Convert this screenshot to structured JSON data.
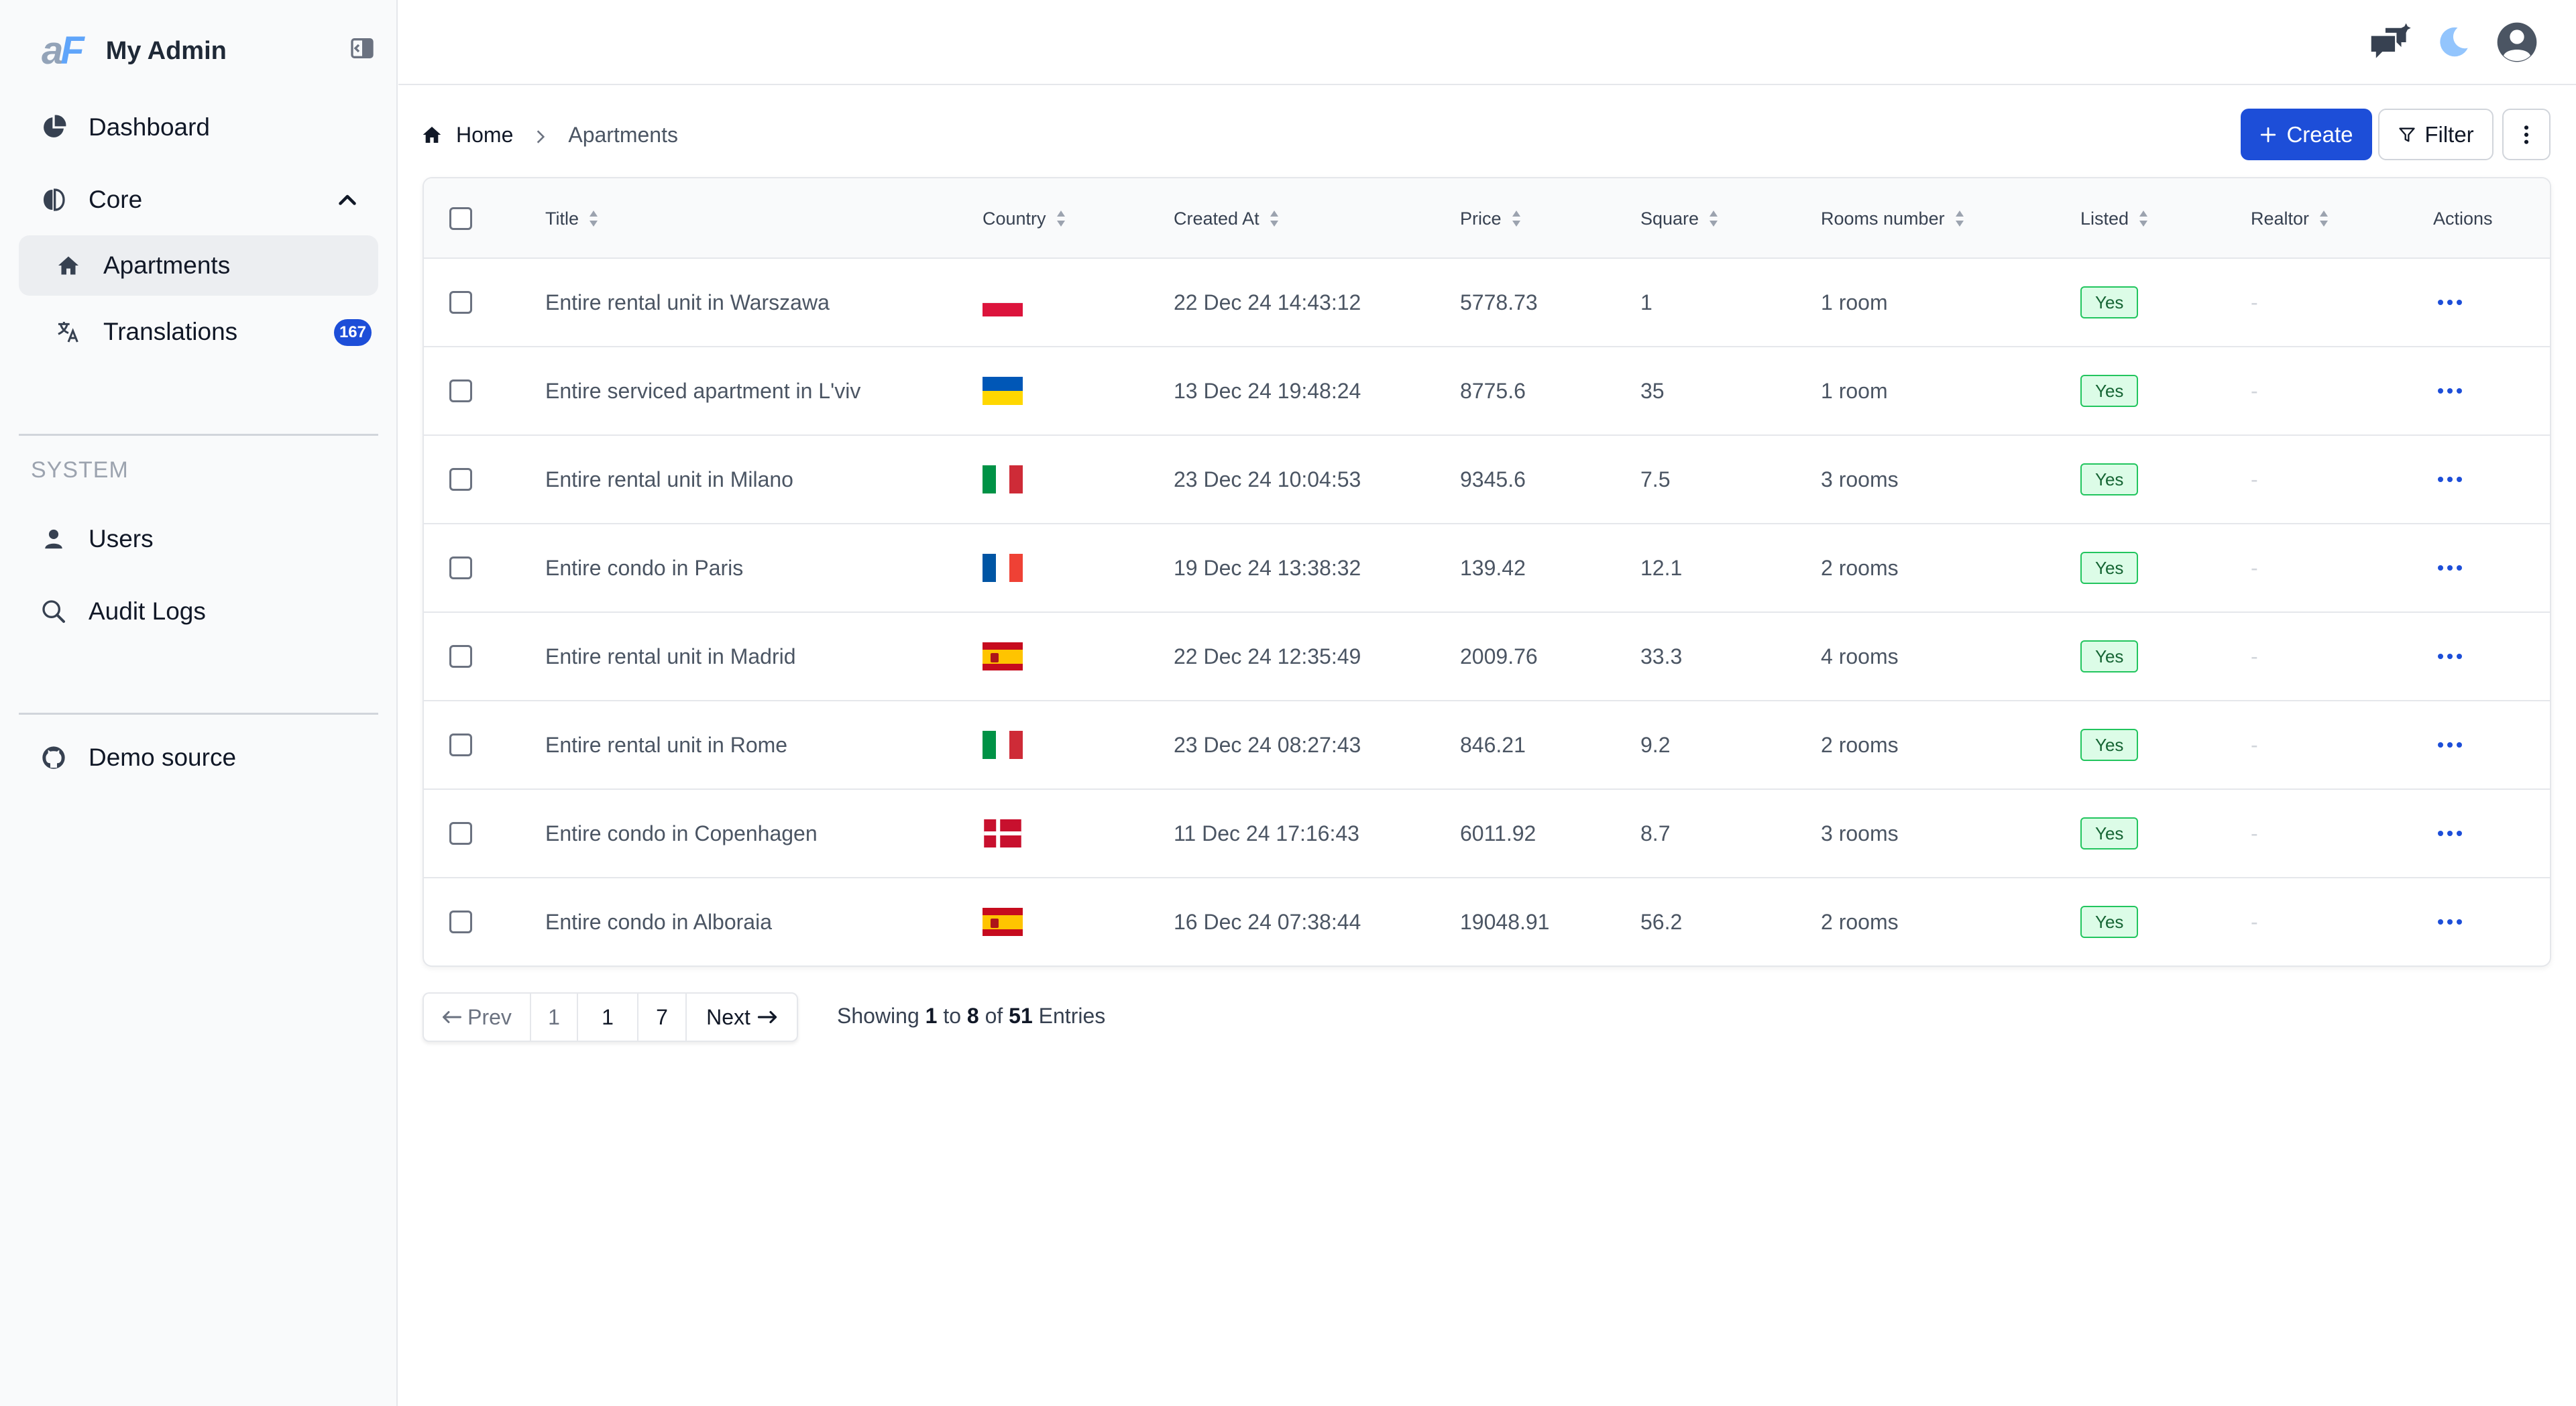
{
  "app": {
    "logo_left": "a",
    "logo_right": "F",
    "name": "My Admin"
  },
  "sidebar": {
    "items": [
      {
        "label": "Dashboard",
        "icon": "pie-chart-icon"
      },
      {
        "label": "Core",
        "icon": "brain-icon",
        "expanded": true
      },
      {
        "label": "Apartments",
        "icon": "home-icon",
        "active": true
      },
      {
        "label": "Translations",
        "icon": "translate-icon",
        "badge": "167"
      }
    ],
    "system_label": "SYSTEM",
    "system_items": [
      {
        "label": "Users",
        "icon": "user-icon"
      },
      {
        "label": "Audit Logs",
        "icon": "search-icon"
      }
    ],
    "footer_items": [
      {
        "label": "Demo source",
        "icon": "github-icon"
      }
    ]
  },
  "breadcrumb": {
    "home": "Home",
    "current": "Apartments"
  },
  "toolbar": {
    "create_label": "Create",
    "filter_label": "Filter"
  },
  "table": {
    "columns": [
      "Title",
      "Country",
      "Created At",
      "Price",
      "Square",
      "Rooms number",
      "Listed",
      "Realtor",
      "Actions"
    ],
    "rows": [
      {
        "title": "Entire rental unit in Warszawa",
        "country": "PL",
        "created_at": "22 Dec 24 14:43:12",
        "price": "5778.73",
        "square": "1",
        "rooms": "1 room",
        "listed": "Yes",
        "realtor": "-"
      },
      {
        "title": "Entire serviced apartment in L'viv",
        "country": "UA",
        "created_at": "13 Dec 24 19:48:24",
        "price": "8775.6",
        "square": "35",
        "rooms": "1 room",
        "listed": "Yes",
        "realtor": "-"
      },
      {
        "title": "Entire rental unit in Milano",
        "country": "IT",
        "created_at": "23 Dec 24 10:04:53",
        "price": "9345.6",
        "square": "7.5",
        "rooms": "3 rooms",
        "listed": "Yes",
        "realtor": "-"
      },
      {
        "title": "Entire condo in Paris",
        "country": "FR",
        "created_at": "19 Dec 24 13:38:32",
        "price": "139.42",
        "square": "12.1",
        "rooms": "2 rooms",
        "listed": "Yes",
        "realtor": "-"
      },
      {
        "title": "Entire rental unit in Madrid",
        "country": "ES",
        "created_at": "22 Dec 24 12:35:49",
        "price": "2009.76",
        "square": "33.3",
        "rooms": "4 rooms",
        "listed": "Yes",
        "realtor": "-"
      },
      {
        "title": "Entire rental unit in Rome",
        "country": "IT",
        "created_at": "23 Dec 24 08:27:43",
        "price": "846.21",
        "square": "9.2",
        "rooms": "2 rooms",
        "listed": "Yes",
        "realtor": "-"
      },
      {
        "title": "Entire condo in Copenhagen",
        "country": "DK",
        "created_at": "11 Dec 24 17:16:43",
        "price": "6011.92",
        "square": "8.7",
        "rooms": "3 rooms",
        "listed": "Yes",
        "realtor": "-"
      },
      {
        "title": "Entire condo in Alboraia",
        "country": "ES",
        "created_at": "16 Dec 24 07:38:44",
        "price": "19048.91",
        "square": "56.2",
        "rooms": "2 rooms",
        "listed": "Yes",
        "realtor": "-"
      }
    ]
  },
  "pagination": {
    "prev_label": "Prev",
    "pages": [
      "1",
      "1",
      "7"
    ],
    "next_label": "Next",
    "showing_prefix": "Showing",
    "from": "1",
    "to_word": "to",
    "to": "8",
    "of_word": "of",
    "total": "51",
    "entries_word": "Entries"
  },
  "colors": {
    "accent": "#1d4ed8",
    "sidebar_bg": "#f9fafb",
    "active_item_bg": "#eceef1",
    "listed_badge_bg": "#dcfce7",
    "listed_badge_border": "#22c55e"
  }
}
